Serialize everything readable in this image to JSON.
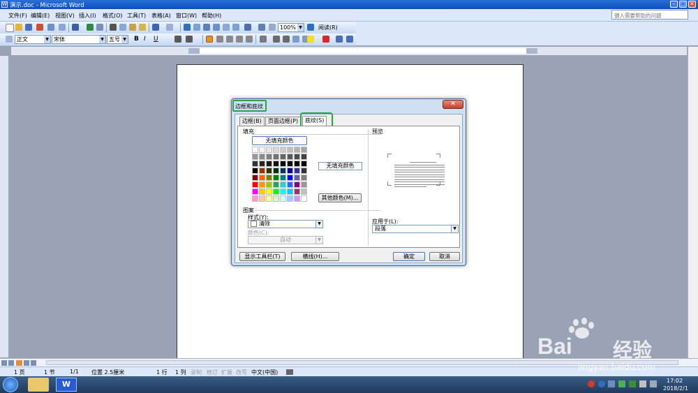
{
  "window": {
    "title": "演示.doc - Microsoft Word"
  },
  "menu": {
    "items": [
      "文件(F)",
      "编辑(E)",
      "视图(V)",
      "插入(I)",
      "格式(O)",
      "工具(T)",
      "表格(A)",
      "窗口(W)",
      "帮助(H)"
    ],
    "help_placeholder": "键入需要帮助的问题"
  },
  "toolbar": {
    "zoom": "100%",
    "read_label": "阅读(R)",
    "style_value": "正文",
    "font_value": "宋体",
    "size_value": "五号",
    "bold": "B",
    "italic": "I",
    "underline": "U"
  },
  "status": {
    "page": "1 页",
    "section": "1 节",
    "pages": "1/1",
    "position": "位置 2.5厘米",
    "line": "1 行",
    "col": "1 列",
    "rec": "录制",
    "rev": "修订",
    "ext": "扩展",
    "ovr": "改写",
    "lang": "中文(中国)"
  },
  "dialog": {
    "title": "边框和底纹",
    "close": "✕",
    "tabs": [
      {
        "label": "边框(B)"
      },
      {
        "label": "页面边框(P)"
      },
      {
        "label": "底纹(S)"
      }
    ],
    "fill_label": "填充",
    "no_fill_button": "无填充颜色",
    "selected_fill": "无填充颜色",
    "more_colors": "其他颜色(M)...",
    "pattern_label": "图案",
    "style_label": "样式(Y):",
    "style_value": "清除",
    "color_label": "颜色(C):",
    "color_value": "自动",
    "preview_label": "预览",
    "apply_label": "应用于(L):",
    "apply_value": "段落",
    "show_toolbar": "显示工具栏(T)",
    "hline": "横线(H)...",
    "ok": "确定",
    "cancel": "取消"
  },
  "palette": [
    [
      "#ffffff",
      "#f2f2f2",
      "#e6e6e6",
      "#d9d9d9",
      "#cccccc",
      "#bfbfbf",
      "#b3b3b3",
      "#a6a6a6"
    ],
    [
      "#999999",
      "#8c8c8c",
      "#808080",
      "#737373",
      "#666666",
      "#595959",
      "#4d4d4d",
      "#404040"
    ],
    [
      "#333333",
      "#262626",
      "#1a1a1a",
      "#111111",
      "#0a0a0a",
      "#050505",
      "#000000",
      "#000000"
    ],
    [
      "#000000",
      "#993300",
      "#333300",
      "#003300",
      "#003366",
      "#000080",
      "#333399",
      "#333333"
    ],
    [
      "#800000",
      "#ff6600",
      "#808000",
      "#008000",
      "#008080",
      "#0000ff",
      "#666699",
      "#808080"
    ],
    [
      "#ff0000",
      "#ff9900",
      "#99cc00",
      "#339966",
      "#33cccc",
      "#3366ff",
      "#800080",
      "#969696"
    ],
    [
      "#ff00ff",
      "#ffcc00",
      "#ffff00",
      "#00ff00",
      "#00ffff",
      "#00ccff",
      "#993366",
      "#c0c0c0"
    ],
    [
      "#ff99cc",
      "#ffcc99",
      "#ffff99",
      "#ccffcc",
      "#ccffff",
      "#99ccff",
      "#cc99ff",
      "#ffffff"
    ]
  ],
  "taskbar": {
    "time": "17:02",
    "date": "2018/2/1"
  },
  "watermark": {
    "brand": "Bai",
    "cn": "经验",
    "url": "jingyan.baidu.com"
  }
}
